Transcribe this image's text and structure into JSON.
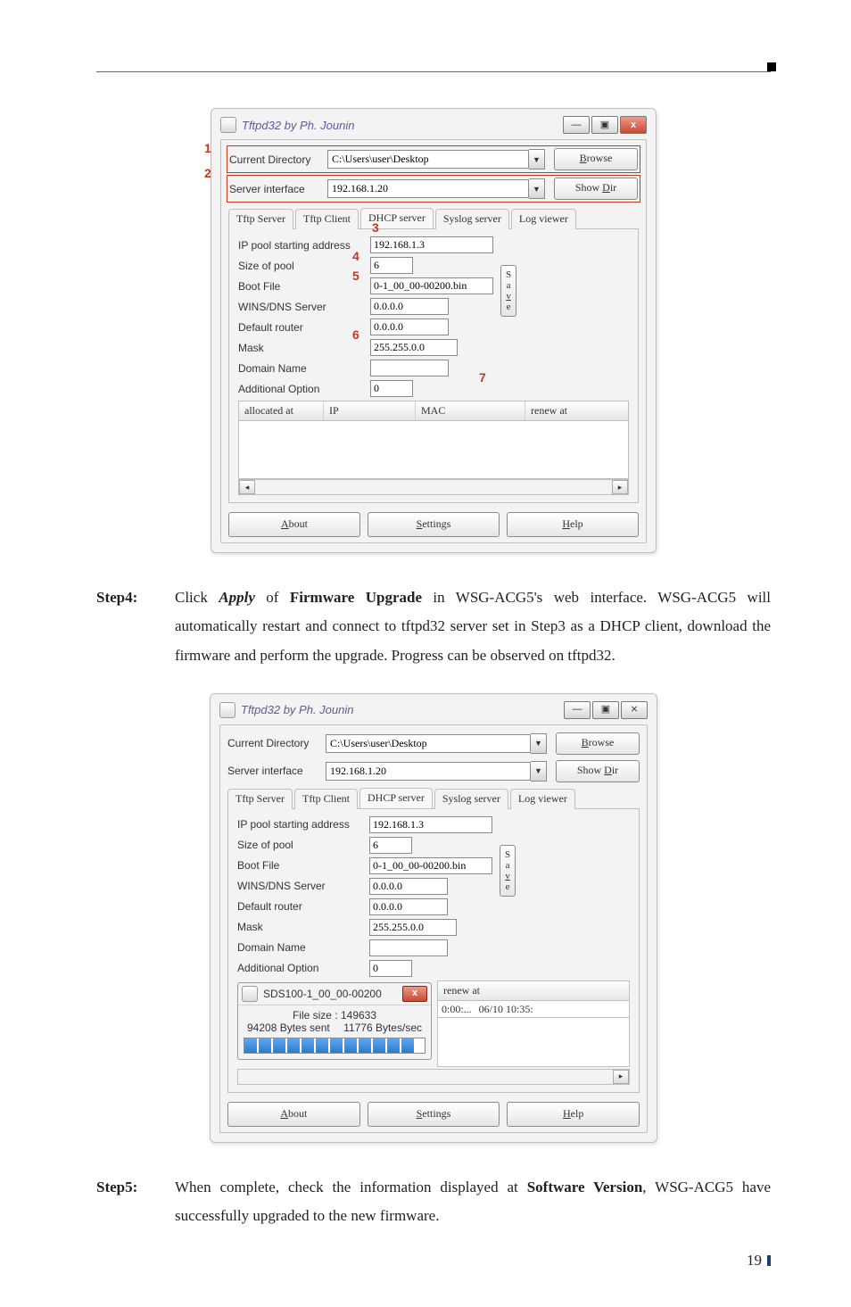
{
  "page_number": "19",
  "win": {
    "title": "Tftpd32 by Ph. Jounin",
    "min": "—",
    "max": "▣",
    "close": "x",
    "curDirLabel": "Current Directory",
    "curDir": "C:\\Users\\user\\Desktop",
    "srvIfLabel": "Server interface",
    "srvIf": "192.168.1.20",
    "btnBrowse_pre": "B",
    "btnBrowse_post": "rowse",
    "btnShowDir_pre": "Show ",
    "btnShowDir_u": "D",
    "btnShowDir_post": "ir",
    "tabs": {
      "t1": "Tftp Server",
      "t2": "Tftp Client",
      "t3": "DHCP server",
      "t4": "Syslog server",
      "t5": "Log viewer"
    },
    "fields": {
      "ipPoolStartLbl": "IP pool starting address",
      "ipPoolStart": "192.168.1.3",
      "sizePoolLbl": "Size of pool",
      "sizePool": "6",
      "bootFileLbl": "Boot File",
      "bootFile": "0-1_00_00-00200.bin",
      "winsLbl": "WINS/DNS Server",
      "wins": "0.0.0.0",
      "defRouterLbl": "Default router",
      "defRouter": "0.0.0.0",
      "maskLbl": "Mask",
      "mask": "255.255.0.0",
      "domainLbl": "Domain Name",
      "domain": "",
      "addOptLbl": "Additional Option",
      "addOpt": "0"
    },
    "save": {
      "s": "S",
      "a": "a",
      "v": "v",
      "e": "e"
    },
    "hdr": {
      "alloc": "allocated at",
      "ip": "IP",
      "mac": "MAC",
      "renew": "renew at"
    },
    "bottom": {
      "about_u": "A",
      "about": "bout",
      "settings_u": "S",
      "settings": "ettings",
      "help_u": "H",
      "help": "elp"
    },
    "ann": {
      "a1": "1",
      "a2": "2",
      "a3": "3",
      "a4": "4",
      "a5": "5",
      "a6": "6",
      "a7": "7"
    }
  },
  "fig2": {
    "popupTitle": "SDS100-1_00_00-00200",
    "fsize": "File size : 149633",
    "sent": "94208 Bytes sent",
    "rate": "11776 Bytes/sec",
    "row": {
      "time": "0:00:...",
      "date": "06/10 10:35:"
    }
  },
  "step4_label": "Step4:",
  "step4_pre": "Click ",
  "step4_apply": "Apply",
  "step4_mid1": " of ",
  "step4_fw": "Firmware Upgrade",
  "step4_rest": " in WSG-ACG5's web interface. WSG-ACG5 will automatically restart and connect to tftpd32 server set in Step3 as a DHCP client, download the firmware and perform the upgrade. Progress can be observed on tftpd32.",
  "step5_label": "Step5:",
  "step5_pre": "When complete, check the information displayed at ",
  "step5_sv": "Software Version",
  "step5_rest": ", WSG-ACG5 have successfully upgraded to the new firmware."
}
